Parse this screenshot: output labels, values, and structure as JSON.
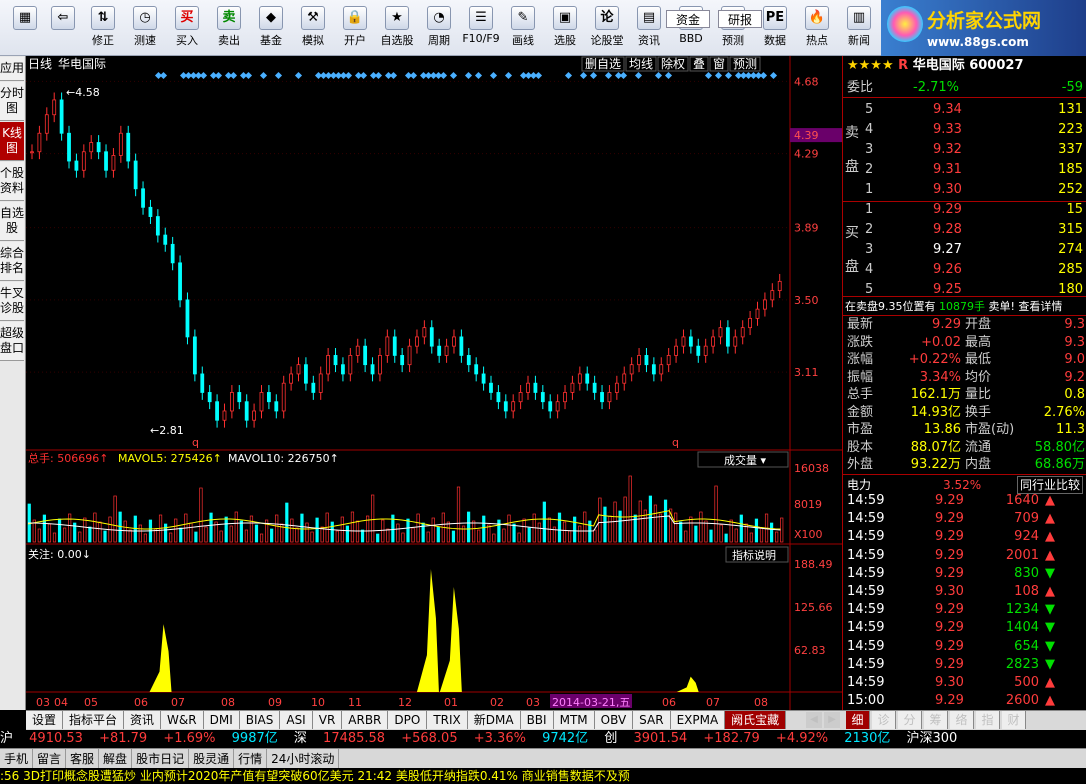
{
  "toolbar": {
    "buttons": [
      {
        "label": "",
        "icon": "menu-icon"
      },
      {
        "label": "",
        "icon": "back-arrow-icon"
      },
      {
        "label": "修正",
        "icon": "updown-icon"
      },
      {
        "label": "测速",
        "icon": "clock-icon"
      },
      {
        "label": "买入",
        "icon": "buy-icon"
      },
      {
        "label": "卖出",
        "icon": "sell-icon"
      },
      {
        "label": "基金",
        "icon": "fund-icon"
      },
      {
        "label": "模拟",
        "icon": "hammer-icon"
      },
      {
        "label": "开户",
        "icon": "lock-icon"
      },
      {
        "label": "自选股",
        "icon": "star-icon"
      },
      {
        "label": "周期",
        "icon": "period-icon"
      },
      {
        "label": "F10/F9",
        "icon": "doc-icon"
      },
      {
        "label": "画线",
        "icon": "pen-icon"
      },
      {
        "label": "选股",
        "icon": "screen-icon"
      },
      {
        "label": "论股堂",
        "icon": "talk-icon"
      },
      {
        "label": "资讯",
        "icon": "news-icon"
      },
      {
        "label": "BBD",
        "icon": "fundflow-icon"
      },
      {
        "label": "预测",
        "icon": "research-icon"
      },
      {
        "label": "数据",
        "icon": "pe-icon"
      },
      {
        "label": "热点",
        "icon": "fire-icon"
      },
      {
        "label": "新闻",
        "icon": "paper-icon"
      }
    ],
    "funds_label": "资金",
    "research_label": "研报",
    "logo_text": "分析家公式网",
    "logo_url": "www.88gs.com"
  },
  "left_tabs": [
    "应用",
    "分时图",
    "K线图",
    "个股资料",
    "自选股",
    "综合排名",
    "牛叉诊股",
    "超级盘口"
  ],
  "chart_header": {
    "period": "日线",
    "stock": "华电国际",
    "right_buttons": [
      "删自选",
      "均线",
      "除权",
      "叠",
      "窗",
      "预测"
    ]
  },
  "chart_data": [
    {
      "type": "candlestick",
      "title": "华电国际 日线",
      "price_ticks": [
        "4.68",
        "4.29",
        "3.89",
        "3.50",
        "3.11"
      ],
      "current_price_tag": "4.39",
      "high_mark": "4.58",
      "low_mark": "2.81",
      "x_ticks": [
        "03",
        "04",
        "05",
        "06",
        "07",
        "08",
        "09",
        "10",
        "11",
        "12",
        "01",
        "02",
        "03",
        "2014-03-21,五",
        "06",
        "07",
        "08"
      ],
      "close": [
        4.3,
        4.4,
        4.5,
        4.58,
        4.4,
        4.25,
        4.2,
        4.3,
        4.35,
        4.3,
        4.2,
        4.28,
        4.4,
        4.25,
        4.1,
        4.0,
        3.95,
        3.85,
        3.8,
        3.7,
        3.5,
        3.3,
        3.1,
        3.0,
        2.95,
        2.85,
        2.9,
        3.0,
        2.95,
        2.85,
        2.9,
        3.0,
        2.95,
        2.9,
        3.05,
        3.1,
        3.15,
        3.05,
        3.0,
        3.1,
        3.2,
        3.15,
        3.1,
        3.2,
        3.25,
        3.15,
        3.1,
        3.2,
        3.3,
        3.2,
        3.15,
        3.25,
        3.3,
        3.35,
        3.25,
        3.2,
        3.25,
        3.3,
        3.2,
        3.15,
        3.1,
        3.05,
        3.0,
        2.95,
        2.9,
        2.95,
        3.0,
        3.05,
        3.0,
        2.95,
        2.9,
        2.95,
        3.0,
        3.05,
        3.1,
        3.05,
        3.0,
        2.95,
        3.0,
        3.05,
        3.1,
        3.15,
        3.2,
        3.15,
        3.1,
        3.15,
        3.2,
        3.25,
        3.3,
        3.25,
        3.2,
        3.25,
        3.3,
        3.35,
        3.25,
        3.3,
        3.35,
        3.4,
        3.45,
        3.5,
        3.55,
        3.6,
        3.55,
        3.6,
        3.5,
        3.45,
        3.3,
        3.2,
        3.25,
        3.35,
        3.55,
        3.75,
        3.9,
        3.85,
        3.8,
        3.75,
        3.7,
        3.65,
        3.7,
        3.75,
        3.7,
        3.65,
        3.6,
        3.6,
        3.55,
        3.5,
        3.55
      ],
      "volume_ticks": [
        "16038",
        "8019",
        "X100"
      ],
      "volume_legend": {
        "total_label": "总手:",
        "total": "506696",
        "ma5_label": "MAVOL5:",
        "ma5": "275426",
        "ma10_label": "MAVOL10:",
        "ma10": "226750"
      },
      "volume_selector": "成交量",
      "indicator_label": "关注:",
      "indicator_value": "0.00",
      "indicator_button": "指标说明",
      "indicator_ticks": [
        "188.49",
        "125.66",
        "62.83"
      ],
      "indicator_peaks": [
        {
          "pos": 0.18,
          "height": 0.53
        },
        {
          "pos": 0.53,
          "height": 0.96
        },
        {
          "pos": 0.56,
          "height": 0.82
        },
        {
          "pos": 0.87,
          "height": 0.12
        }
      ]
    }
  ],
  "bottom_tabs": [
    "设置",
    "指标平台",
    "资讯",
    "W&R",
    "DMI",
    "BIAS",
    "ASI",
    "VR",
    "ARBR",
    "DPO",
    "TRIX",
    "新DMA",
    "BBI",
    "MTM",
    "OBV",
    "SAR",
    "EXPMA",
    "阙氏宝藏"
  ],
  "panel_tabs": [
    "细",
    "诊",
    "分",
    "筹",
    "络",
    "指",
    "财"
  ],
  "quote": {
    "stars": "★★★★",
    "r_mark": "R",
    "name": "华电国际",
    "code": "600027",
    "weibi_label": "委比",
    "weibi": "-2.71%",
    "weicha": "-59",
    "sell_label": "卖盘",
    "buy_label": "买盘",
    "asks": [
      {
        "lvl": "5",
        "price": "9.34",
        "vol": "131"
      },
      {
        "lvl": "4",
        "price": "9.33",
        "vol": "223"
      },
      {
        "lvl": "3",
        "price": "9.32",
        "vol": "337"
      },
      {
        "lvl": "2",
        "price": "9.31",
        "vol": "185"
      },
      {
        "lvl": "1",
        "price": "9.30",
        "vol": "252"
      }
    ],
    "bids": [
      {
        "lvl": "1",
        "price": "9.29",
        "vol": "15"
      },
      {
        "lvl": "2",
        "price": "9.28",
        "vol": "315"
      },
      {
        "lvl": "3",
        "price": "9.27",
        "vol": "274"
      },
      {
        "lvl": "4",
        "price": "9.26",
        "vol": "285"
      },
      {
        "lvl": "5",
        "price": "9.25",
        "vol": "180"
      }
    ],
    "notice_a": "在卖盘9.35位置有",
    "notice_b": "10879手",
    "notice_c": "卖单! 查看详情",
    "stats": [
      {
        "l": "最新",
        "v": "9.29",
        "l2": "开盘",
        "v2": "9.3"
      },
      {
        "l": "涨跌",
        "v": "+0.02",
        "l2": "最高",
        "v2": "9.3"
      },
      {
        "l": "涨幅",
        "v": "+0.22%",
        "l2": "最低",
        "v2": "9.0"
      },
      {
        "l": "振幅",
        "v": "3.34%",
        "l2": "均价",
        "v2": "9.2"
      },
      {
        "l": "总手",
        "v": "162.1万",
        "l2": "量比",
        "v2": "0.8"
      },
      {
        "l": "金额",
        "v": "14.93亿",
        "l2": "换手",
        "v2": "2.76%"
      },
      {
        "l": "市盈",
        "v": "13.86",
        "l2": "市盈(动)",
        "v2": "11.3"
      },
      {
        "l": "股本",
        "v": "88.07亿",
        "l2": "流通",
        "v2": "58.80亿"
      },
      {
        "l": "外盘",
        "v": "93.22万",
        "l2": "内盘",
        "v2": "68.86万"
      }
    ],
    "sector": "电力",
    "sector_pct": "3.52%",
    "compare_btn": "同行业比较",
    "ticks": [
      {
        "t": "14:59",
        "p": "9.29",
        "v": "1640",
        "d": "up"
      },
      {
        "t": "14:59",
        "p": "9.29",
        "v": "709",
        "d": "up"
      },
      {
        "t": "14:59",
        "p": "9.29",
        "v": "924",
        "d": "up"
      },
      {
        "t": "14:59",
        "p": "9.29",
        "v": "2001",
        "d": "up"
      },
      {
        "t": "14:59",
        "p": "9.29",
        "v": "830",
        "d": "down"
      },
      {
        "t": "14:59",
        "p": "9.30",
        "v": "108",
        "d": "up"
      },
      {
        "t": "14:59",
        "p": "9.29",
        "v": "1234",
        "d": "down"
      },
      {
        "t": "14:59",
        "p": "9.29",
        "v": "1404",
        "d": "down"
      },
      {
        "t": "14:59",
        "p": "9.29",
        "v": "654",
        "d": "down"
      },
      {
        "t": "14:59",
        "p": "9.29",
        "v": "2823",
        "d": "down"
      },
      {
        "t": "14:59",
        "p": "9.30",
        "v": "500",
        "d": "up"
      },
      {
        "t": "15:00",
        "p": "9.29",
        "v": "2600",
        "d": "up"
      }
    ]
  },
  "ticker": {
    "sh_label": "沪",
    "sh": "4910.53",
    "sh_chg": "+81.79",
    "sh_pct": "+1.69%",
    "sh_amt": "9987亿",
    "sz_label": "深",
    "sz": "17485.58",
    "sz_chg": "+568.05",
    "sz_pct": "+3.36%",
    "sz_amt": "9742亿",
    "cy_label": "创",
    "cy": "3901.54",
    "cy_chg": "+182.79",
    "cy_pct": "+4.92%",
    "cy_amt": "2130亿",
    "hs300": "沪深300"
  },
  "statusbar": [
    "手机",
    "留言",
    "客服",
    "解盘",
    "股市日记",
    "股灵通",
    "行情",
    "24小时滚动"
  ],
  "news": ":56 3D打印概念股遭猛炒 业内预计2020年产值有望突破60亿美元     21:42 美股低开纳指跌0.41% 商业销售数据不及预"
}
